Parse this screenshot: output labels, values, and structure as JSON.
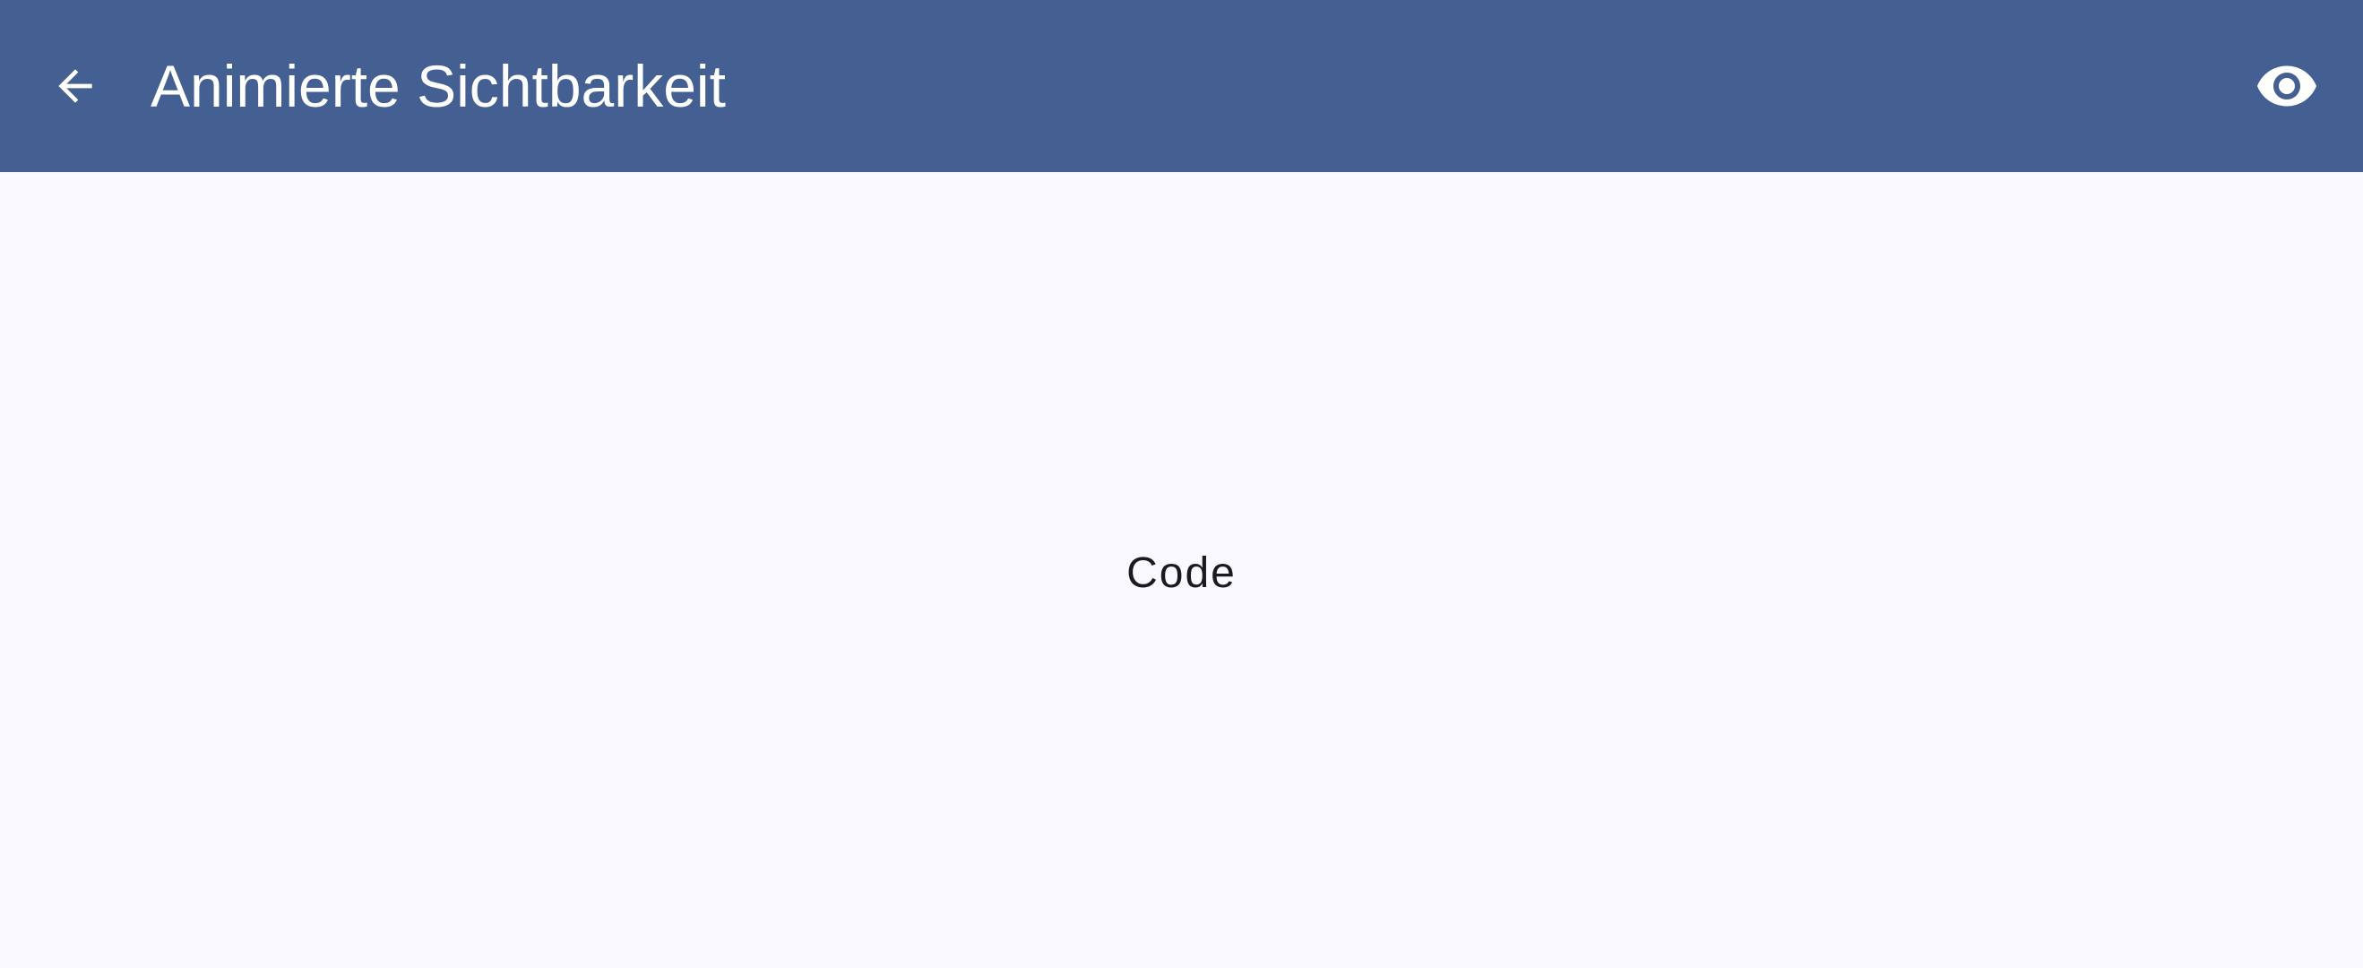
{
  "app_bar": {
    "title": "Animierte Sichtbarkeit",
    "background_color": "#445f91",
    "back_icon": "arrow-back-icon",
    "action_icon": "eye-icon"
  },
  "main": {
    "center_text": "Code",
    "background_color": "#f9f9fe"
  }
}
